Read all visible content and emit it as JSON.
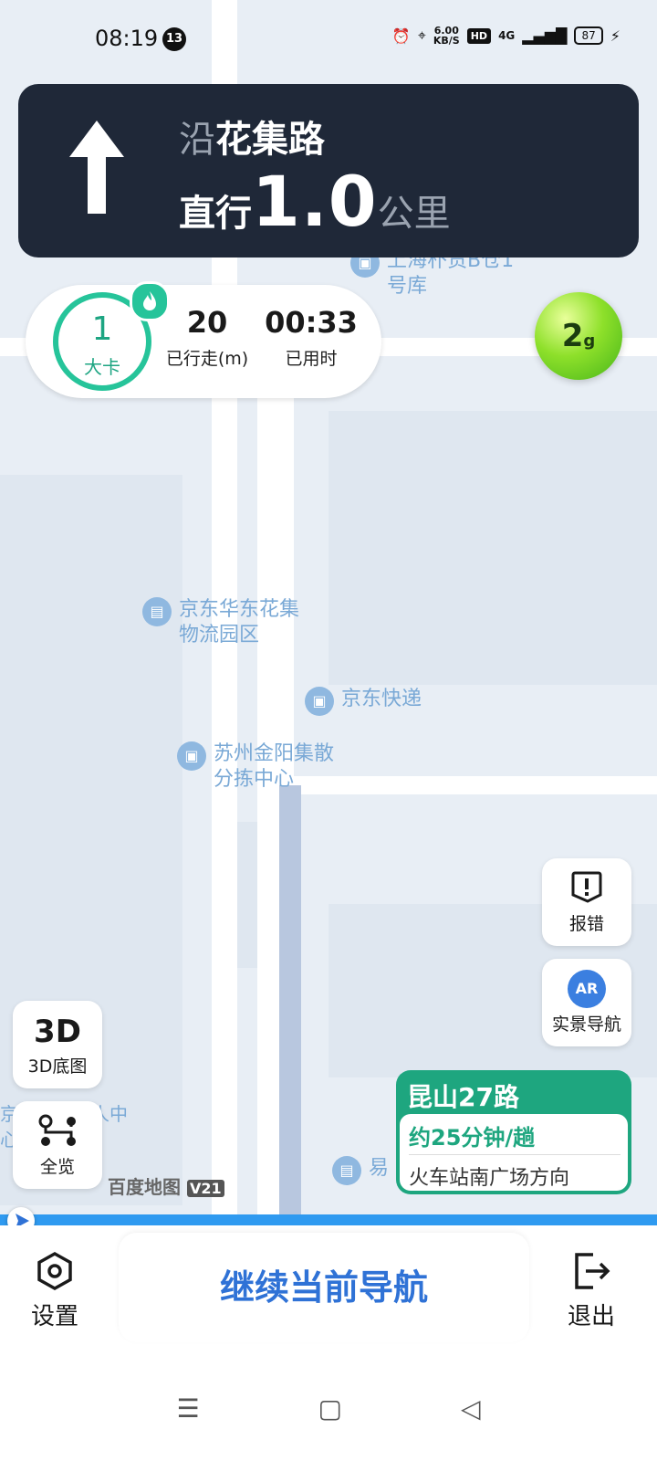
{
  "status_bar": {
    "time": "08:19",
    "notification_count": "13",
    "net_speed_value": "6.00",
    "net_speed_unit": "KB/S",
    "hd": "HD",
    "network": "4G",
    "battery": "87"
  },
  "navigation": {
    "road_prefix": "沿",
    "road_name": "花集路",
    "action": "直行",
    "distance": "1.0",
    "distance_unit": "公里"
  },
  "speed": {
    "value": "1",
    "label": "大卡"
  },
  "stats": {
    "distance_value": "20",
    "distance_label": "已行走(m)",
    "time_value": "00:33",
    "time_label": "已用时"
  },
  "eco": {
    "value": "2",
    "unit": "g"
  },
  "map_pois": [
    "上海朴货B仓1号库",
    "京东华东花集物流园区",
    "京东快递",
    "苏州金阳集散分拣中心",
    "京东昆山无人中心",
    "易"
  ],
  "buttons": {
    "report": "报错",
    "ar": "实景导航",
    "ar_icon_text": "AR",
    "btn3d_icon": "3D",
    "btn3d_label": "3D底图",
    "overview": "全览"
  },
  "bus_card": {
    "route": "昆山27路",
    "eta": "约25分钟/趟",
    "direction": "火车站南广场方向"
  },
  "map_logo": {
    "name": "百度地图",
    "version": "V21"
  },
  "bottom_bar": {
    "settings": "设置",
    "continue": "继续当前导航",
    "exit": "退出"
  },
  "colors": {
    "nav_panel": "#1f2838",
    "accent_green": "#1ea67f",
    "primary_blue": "#2f72d6",
    "route_blue": "#2f9af0"
  }
}
